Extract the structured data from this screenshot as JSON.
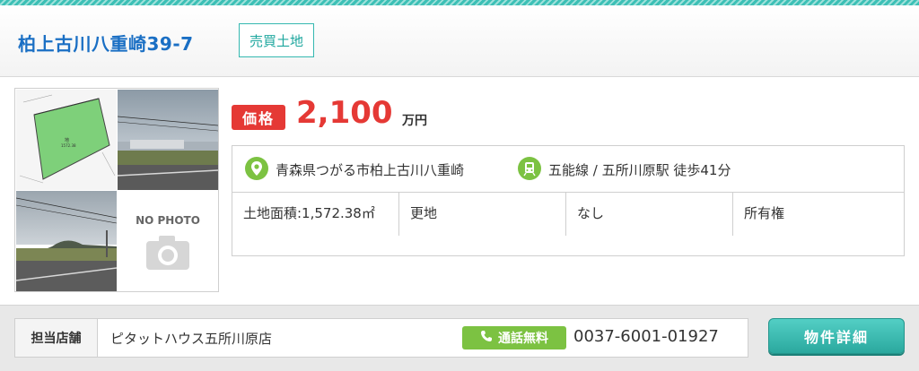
{
  "header": {
    "title": "柏上古川八重崎39-7",
    "type_badge": "売買土地"
  },
  "photos": {
    "nophoto_label": "NO PHOTO",
    "items": [
      {
        "kind": "survey-map-photo"
      },
      {
        "kind": "field-street-photo"
      },
      {
        "kind": "road-field-photo"
      },
      {
        "kind": "no-photo-placeholder"
      }
    ]
  },
  "price": {
    "label": "価格",
    "value": "2,100",
    "unit": "万円"
  },
  "info": {
    "address": "青森県つがる市柏上古川八重崎",
    "address_icon": "map-pin-icon",
    "station": "五能線 / 五所川原駅 徒歩41分",
    "station_icon": "train-icon",
    "cells": [
      "土地面積:1,572.38㎡",
      "更地",
      "なし",
      "所有権"
    ]
  },
  "footer": {
    "shop_label": "担当店舗",
    "shop_name": "ピタットハウス五所川原店",
    "free_call_label": "通話無料",
    "phone_number": "0037-6001-01927",
    "detail_button": "物件詳細"
  },
  "colors": {
    "accent_teal": "#3cc0b6",
    "title_blue": "#1a6fc4",
    "price_red": "#e53935",
    "call_green": "#7cc242"
  }
}
